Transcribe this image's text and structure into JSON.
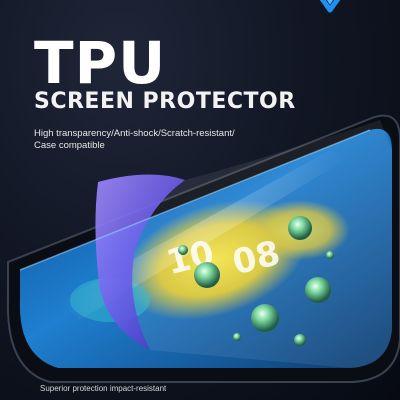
{
  "brand": {
    "logo_icon": "shield-logo-icon"
  },
  "product": {
    "title": "TPU",
    "subtitle": "SCREEN PROTECTOR",
    "features_line1": "High transparency/Anti-shock/Scratch-resistant/",
    "features_line2": "Case compatible",
    "footer": "Superior protection impact-resistant"
  },
  "phone": {
    "time_hours": "10",
    "time_minutes": "08"
  },
  "colors": {
    "background": "#0b0f19",
    "text": "#ffffff",
    "screen_blue": "#1f7fd0",
    "screen_yellow": "#e8d640",
    "film_purple": "#6c5be8"
  }
}
